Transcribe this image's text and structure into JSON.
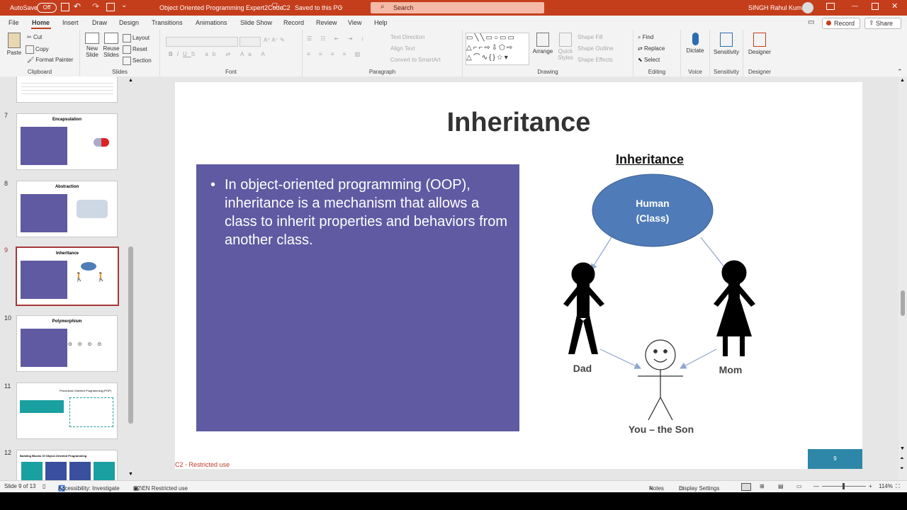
{
  "titlebar": {
    "autosave_label": "AutoSave",
    "autosave_state": "Off",
    "doc_title": "Object Oriented Programming Expert2Code",
    "label_c2": "C2",
    "saved_status": "Saved to this PC",
    "search_placeholder": "Search",
    "user_name": "SINGH Rahul Kumar"
  },
  "tabs": [
    "File",
    "Home",
    "Insert",
    "Draw",
    "Design",
    "Transitions",
    "Animations",
    "Slide Show",
    "Record",
    "Review",
    "View",
    "Help"
  ],
  "active_tab": "Home",
  "top_right": {
    "record_btn": "Record",
    "share_btn": "Share"
  },
  "ribbon": {
    "clipboard": {
      "paste": "Paste",
      "cut": "Cut",
      "copy": "Copy",
      "format_painter": "Format Painter",
      "label": "Clipboard"
    },
    "slides": {
      "new_slide": "New Slide",
      "reuse_slides": "Reuse Slides",
      "layout": "Layout",
      "reset": "Reset",
      "section": "Section",
      "label": "Slides"
    },
    "font": {
      "label": "Font"
    },
    "paragraph": {
      "text_direction": "Text Direction",
      "align_text": "Align Text",
      "convert_smartart": "Convert to SmartArt",
      "label": "Paragraph"
    },
    "drawing": {
      "arrange": "Arrange",
      "quick_styles": "Quick Styles",
      "shape_fill": "Shape Fill",
      "shape_outline": "Shape Outline",
      "shape_effects": "Shape Effects",
      "label": "Drawing"
    },
    "editing": {
      "find": "Find",
      "replace": "Replace",
      "select": "Select",
      "label": "Editing"
    },
    "voice": {
      "dictate": "Dictate",
      "label": "Voice"
    },
    "sensitivity": {
      "btn": "Sensitivity",
      "label": "Sensitivity"
    },
    "designer": {
      "btn": "Designer",
      "label": "Designer"
    }
  },
  "thumbnails": [
    {
      "num": "7",
      "title": "Encapsulation"
    },
    {
      "num": "8",
      "title": "Abstraction"
    },
    {
      "num": "9",
      "title": "Inheritance"
    },
    {
      "num": "10",
      "title": "Polymorphism"
    },
    {
      "num": "11",
      "title": "Procedural Oriented Programming (POP)"
    },
    {
      "num": "12",
      "title": "Building Blocks Of Object-Oriented Programming"
    }
  ],
  "slide": {
    "title": "Inheritance",
    "bullet": "In object-oriented programming (OOP), inheritance is a mechanism that allows a class to inherit properties and behaviors from another class.",
    "diagram_heading": "Inheritance",
    "class_line1": "Human",
    "class_line2": "(Class)",
    "dad": "Dad",
    "mom": "Mom",
    "son": "You – the Son",
    "footer": "C2 - Restricted use",
    "page_number": "9",
    "panel_color": "#5f5aa2",
    "ellipse_color": "#4f7cb8",
    "badge_color": "#2e87a8"
  },
  "status": {
    "slide_of": "Slide 9 of 13",
    "accessibility": "Accessibility: Investigate",
    "restricted": "C2\\EN Restricted use",
    "notes": "Notes",
    "display_settings": "Display Settings",
    "zoom": "114%"
  }
}
